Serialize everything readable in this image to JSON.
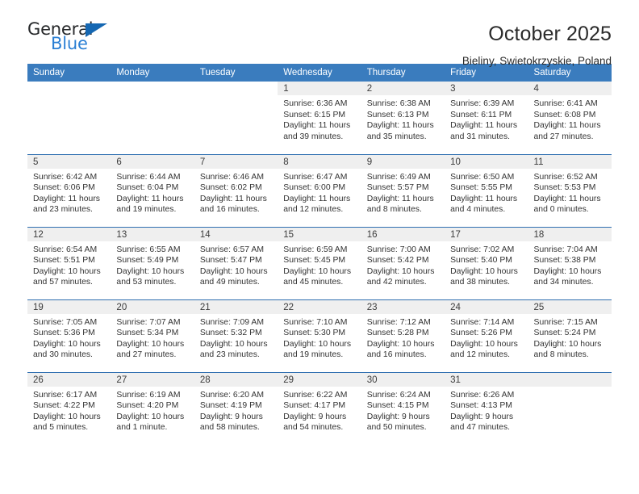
{
  "logo": {
    "word_one": "General",
    "word_two": "Blue",
    "triangle": "blue-triangle"
  },
  "header": {
    "title": "October 2025",
    "subtitle": "Bieliny, Swietokrzyskie, Poland"
  },
  "colors": {
    "header_blue": "#3a7cbe",
    "row_divider_blue": "#2f6fb0",
    "daynum_bg": "#efefef",
    "logo_blue": "#2a7fd4",
    "text": "#333333"
  },
  "labels": {
    "sunrise": "Sunrise:",
    "sunset": "Sunset:",
    "daylight": "Daylight:"
  },
  "weekday_headers": [
    "Sunday",
    "Monday",
    "Tuesday",
    "Wednesday",
    "Thursday",
    "Friday",
    "Saturday"
  ],
  "weeks": [
    [
      {
        "day": "",
        "empty": true
      },
      {
        "day": "",
        "empty": true
      },
      {
        "day": "",
        "empty": true
      },
      {
        "day": "1",
        "sunrise": "Sunrise: 6:36 AM",
        "sunset": "Sunset: 6:15 PM",
        "daylight_1": "Daylight: 11 hours",
        "daylight_2": "and 39 minutes."
      },
      {
        "day": "2",
        "sunrise": "Sunrise: 6:38 AM",
        "sunset": "Sunset: 6:13 PM",
        "daylight_1": "Daylight: 11 hours",
        "daylight_2": "and 35 minutes."
      },
      {
        "day": "3",
        "sunrise": "Sunrise: 6:39 AM",
        "sunset": "Sunset: 6:11 PM",
        "daylight_1": "Daylight: 11 hours",
        "daylight_2": "and 31 minutes."
      },
      {
        "day": "4",
        "sunrise": "Sunrise: 6:41 AM",
        "sunset": "Sunset: 6:08 PM",
        "daylight_1": "Daylight: 11 hours",
        "daylight_2": "and 27 minutes."
      }
    ],
    [
      {
        "day": "5",
        "sunrise": "Sunrise: 6:42 AM",
        "sunset": "Sunset: 6:06 PM",
        "daylight_1": "Daylight: 11 hours",
        "daylight_2": "and 23 minutes."
      },
      {
        "day": "6",
        "sunrise": "Sunrise: 6:44 AM",
        "sunset": "Sunset: 6:04 PM",
        "daylight_1": "Daylight: 11 hours",
        "daylight_2": "and 19 minutes."
      },
      {
        "day": "7",
        "sunrise": "Sunrise: 6:46 AM",
        "sunset": "Sunset: 6:02 PM",
        "daylight_1": "Daylight: 11 hours",
        "daylight_2": "and 16 minutes."
      },
      {
        "day": "8",
        "sunrise": "Sunrise: 6:47 AM",
        "sunset": "Sunset: 6:00 PM",
        "daylight_1": "Daylight: 11 hours",
        "daylight_2": "and 12 minutes."
      },
      {
        "day": "9",
        "sunrise": "Sunrise: 6:49 AM",
        "sunset": "Sunset: 5:57 PM",
        "daylight_1": "Daylight: 11 hours",
        "daylight_2": "and 8 minutes."
      },
      {
        "day": "10",
        "sunrise": "Sunrise: 6:50 AM",
        "sunset": "Sunset: 5:55 PM",
        "daylight_1": "Daylight: 11 hours",
        "daylight_2": "and 4 minutes."
      },
      {
        "day": "11",
        "sunrise": "Sunrise: 6:52 AM",
        "sunset": "Sunset: 5:53 PM",
        "daylight_1": "Daylight: 11 hours",
        "daylight_2": "and 0 minutes."
      }
    ],
    [
      {
        "day": "12",
        "sunrise": "Sunrise: 6:54 AM",
        "sunset": "Sunset: 5:51 PM",
        "daylight_1": "Daylight: 10 hours",
        "daylight_2": "and 57 minutes."
      },
      {
        "day": "13",
        "sunrise": "Sunrise: 6:55 AM",
        "sunset": "Sunset: 5:49 PM",
        "daylight_1": "Daylight: 10 hours",
        "daylight_2": "and 53 minutes."
      },
      {
        "day": "14",
        "sunrise": "Sunrise: 6:57 AM",
        "sunset": "Sunset: 5:47 PM",
        "daylight_1": "Daylight: 10 hours",
        "daylight_2": "and 49 minutes."
      },
      {
        "day": "15",
        "sunrise": "Sunrise: 6:59 AM",
        "sunset": "Sunset: 5:45 PM",
        "daylight_1": "Daylight: 10 hours",
        "daylight_2": "and 45 minutes."
      },
      {
        "day": "16",
        "sunrise": "Sunrise: 7:00 AM",
        "sunset": "Sunset: 5:42 PM",
        "daylight_1": "Daylight: 10 hours",
        "daylight_2": "and 42 minutes."
      },
      {
        "day": "17",
        "sunrise": "Sunrise: 7:02 AM",
        "sunset": "Sunset: 5:40 PM",
        "daylight_1": "Daylight: 10 hours",
        "daylight_2": "and 38 minutes."
      },
      {
        "day": "18",
        "sunrise": "Sunrise: 7:04 AM",
        "sunset": "Sunset: 5:38 PM",
        "daylight_1": "Daylight: 10 hours",
        "daylight_2": "and 34 minutes."
      }
    ],
    [
      {
        "day": "19",
        "sunrise": "Sunrise: 7:05 AM",
        "sunset": "Sunset: 5:36 PM",
        "daylight_1": "Daylight: 10 hours",
        "daylight_2": "and 30 minutes."
      },
      {
        "day": "20",
        "sunrise": "Sunrise: 7:07 AM",
        "sunset": "Sunset: 5:34 PM",
        "daylight_1": "Daylight: 10 hours",
        "daylight_2": "and 27 minutes."
      },
      {
        "day": "21",
        "sunrise": "Sunrise: 7:09 AM",
        "sunset": "Sunset: 5:32 PM",
        "daylight_1": "Daylight: 10 hours",
        "daylight_2": "and 23 minutes."
      },
      {
        "day": "22",
        "sunrise": "Sunrise: 7:10 AM",
        "sunset": "Sunset: 5:30 PM",
        "daylight_1": "Daylight: 10 hours",
        "daylight_2": "and 19 minutes."
      },
      {
        "day": "23",
        "sunrise": "Sunrise: 7:12 AM",
        "sunset": "Sunset: 5:28 PM",
        "daylight_1": "Daylight: 10 hours",
        "daylight_2": "and 16 minutes."
      },
      {
        "day": "24",
        "sunrise": "Sunrise: 7:14 AM",
        "sunset": "Sunset: 5:26 PM",
        "daylight_1": "Daylight: 10 hours",
        "daylight_2": "and 12 minutes."
      },
      {
        "day": "25",
        "sunrise": "Sunrise: 7:15 AM",
        "sunset": "Sunset: 5:24 PM",
        "daylight_1": "Daylight: 10 hours",
        "daylight_2": "and 8 minutes."
      }
    ],
    [
      {
        "day": "26",
        "sunrise": "Sunrise: 6:17 AM",
        "sunset": "Sunset: 4:22 PM",
        "daylight_1": "Daylight: 10 hours",
        "daylight_2": "and 5 minutes."
      },
      {
        "day": "27",
        "sunrise": "Sunrise: 6:19 AM",
        "sunset": "Sunset: 4:20 PM",
        "daylight_1": "Daylight: 10 hours",
        "daylight_2": "and 1 minute."
      },
      {
        "day": "28",
        "sunrise": "Sunrise: 6:20 AM",
        "sunset": "Sunset: 4:19 PM",
        "daylight_1": "Daylight: 9 hours",
        "daylight_2": "and 58 minutes."
      },
      {
        "day": "29",
        "sunrise": "Sunrise: 6:22 AM",
        "sunset": "Sunset: 4:17 PM",
        "daylight_1": "Daylight: 9 hours",
        "daylight_2": "and 54 minutes."
      },
      {
        "day": "30",
        "sunrise": "Sunrise: 6:24 AM",
        "sunset": "Sunset: 4:15 PM",
        "daylight_1": "Daylight: 9 hours",
        "daylight_2": "and 50 minutes."
      },
      {
        "day": "31",
        "sunrise": "Sunrise: 6:26 AM",
        "sunset": "Sunset: 4:13 PM",
        "daylight_1": "Daylight: 9 hours",
        "daylight_2": "and 47 minutes."
      },
      {
        "day": "",
        "empty": true
      }
    ]
  ]
}
